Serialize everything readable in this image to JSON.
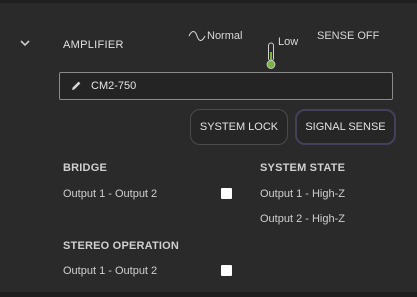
{
  "header": {
    "title": "AMPLIFIER",
    "modes": {
      "normal": "Normal",
      "low": "Low",
      "sense": "SENSE OFF"
    },
    "icons": {
      "collapse": "chevron-down-icon",
      "normal": "sine-wave-icon",
      "low": "thermometer-icon"
    }
  },
  "device": {
    "name": "CM2-750",
    "icon": "pencil-icon"
  },
  "buttons": {
    "system_lock": "SYSTEM LOCK",
    "signal_sense": "SIGNAL SENSE"
  },
  "bridge": {
    "heading": "BRIDGE",
    "pair_label": "Output 1 - Output 2",
    "checked": false
  },
  "system_state": {
    "heading": "SYSTEM STATE",
    "lines": [
      "Output 1 - High-Z",
      "Output 2 - High-Z"
    ]
  },
  "stereo": {
    "heading": "STEREO OPERATION",
    "pair_label": "Output 1 - Output 2",
    "checked": false
  },
  "colors": {
    "background": "#2a2a2a",
    "thermometer_green": "#7cb342",
    "signal_sense_border": "#45405a"
  }
}
